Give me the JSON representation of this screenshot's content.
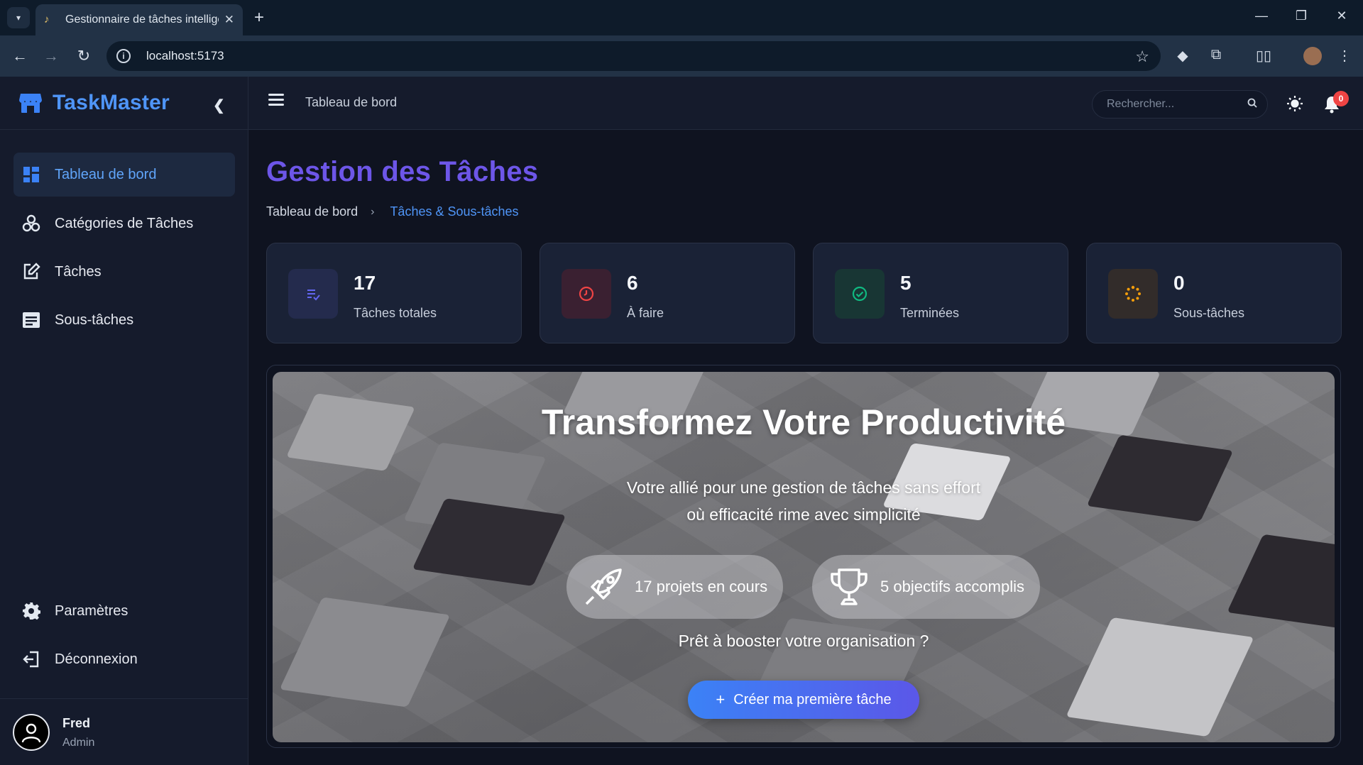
{
  "browser": {
    "tab_title": "Gestionnaire de tâches intellige",
    "url": "localhost:5173"
  },
  "sidebar": {
    "brand": "TaskMaster",
    "items": [
      {
        "label": "Tableau de bord",
        "icon": "dashboard-icon",
        "active": true
      },
      {
        "label": "Catégories de Tâches",
        "icon": "categories-icon",
        "active": false
      },
      {
        "label": "Tâches",
        "icon": "edit-icon",
        "active": false
      },
      {
        "label": "Sous-tâches",
        "icon": "list-icon",
        "active": false
      }
    ],
    "bottom_items": [
      {
        "label": "Paramètres",
        "icon": "gear-icon"
      },
      {
        "label": "Déconnexion",
        "icon": "logout-icon"
      }
    ],
    "user": {
      "name": "Fred",
      "role": "Admin"
    }
  },
  "header": {
    "title": "Tableau de bord",
    "search_placeholder": "Rechercher...",
    "notification_count": "0"
  },
  "main": {
    "page_title": "Gestion des Tâches",
    "breadcrumb": [
      "Tableau de bord",
      "Tâches & Sous-tâches"
    ],
    "stats": [
      {
        "value": "17",
        "label": "Tâches totales",
        "icon": "tasks-icon",
        "color": "#6366f1"
      },
      {
        "value": "6",
        "label": "À faire",
        "icon": "clock-icon",
        "color": "#ef4444"
      },
      {
        "value": "5",
        "label": "Terminées",
        "icon": "check-circle-icon",
        "color": "#10b981"
      },
      {
        "value": "0",
        "label": "Sous-tâches",
        "icon": "spinner-icon",
        "color": "#f59e0b"
      }
    ],
    "hero": {
      "title": "Transformez Votre Productivité",
      "subtitle_line1": "Votre allié pour une gestion de tâches sans effort",
      "subtitle_line2": "où efficacité rime avec simplicité",
      "pill1": "17 projets en cours",
      "pill2": "5 objectifs accomplis",
      "question": "Prêt à booster votre organisation ?",
      "cta": "Créer ma première tâche"
    }
  },
  "colors": {
    "accent": "#3b82f6",
    "title": "#6d56e8",
    "sidebar_bg": "#151b2c",
    "main_bg": "#0f1320"
  }
}
